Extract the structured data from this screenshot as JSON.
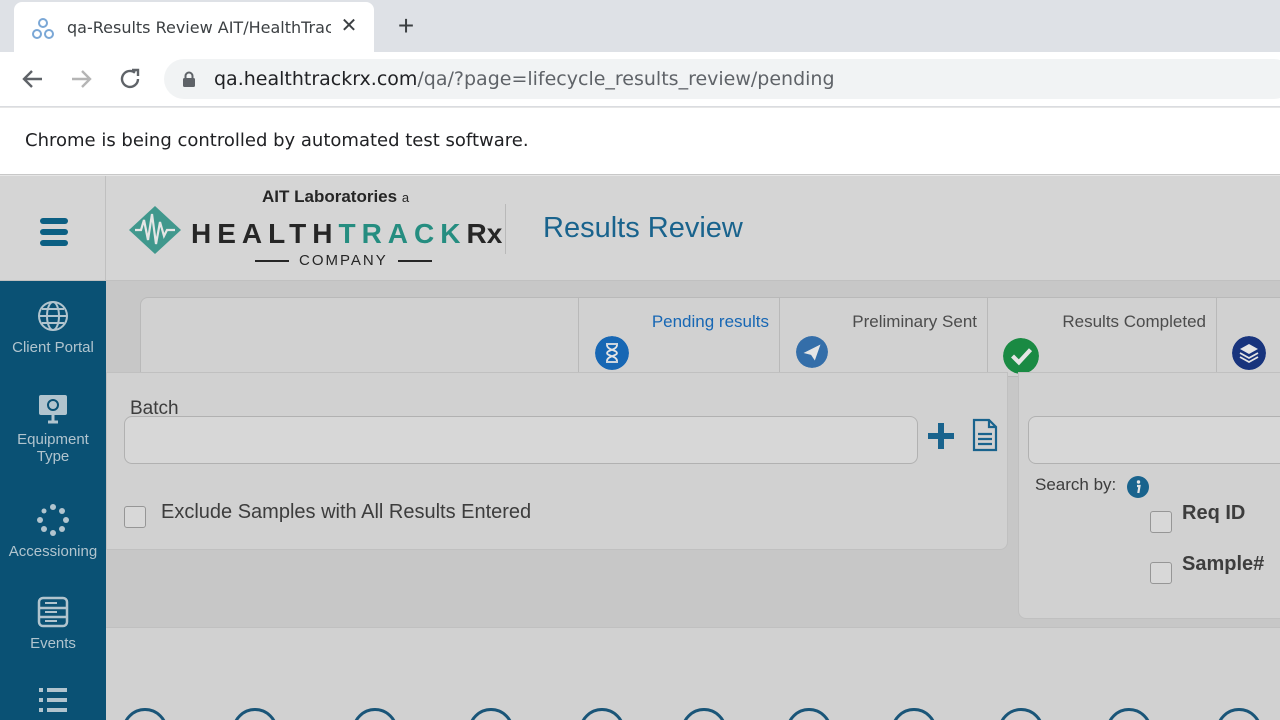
{
  "browser": {
    "tab_title": "qa-Results Review AIT/HealthTrackRx",
    "url_host": "qa.healthtrackrx.com",
    "url_path": "/qa/?page=lifecycle_results_review/pending",
    "infobar_text": "Chrome is being controlled by automated test software."
  },
  "header": {
    "logo_top": "AIT Laboratories",
    "logo_top_suffix": "a",
    "logo_main_a": "HEALTH",
    "logo_main_b": "TRACK",
    "logo_main_c": "Rx",
    "logo_company": "COMPANY",
    "page_title": "Results Review"
  },
  "sidebar": {
    "items": [
      {
        "label": "Client Portal",
        "icon": "globe-icon"
      },
      {
        "label": "Equipment Type",
        "icon": "monitor-icon"
      },
      {
        "label": "Accessioning",
        "icon": "spinner-icon"
      },
      {
        "label": "Events",
        "icon": "server-icon"
      },
      {
        "label": "",
        "icon": "list-icon"
      }
    ]
  },
  "status_tabs": [
    {
      "label": "Pending results",
      "icon": "hourglass-icon",
      "color": "#1a73c9"
    },
    {
      "label": "Preliminary Sent",
      "icon": "paper-plane-icon",
      "color": "#3a7bbd"
    },
    {
      "label": "Results Completed",
      "icon": "check-icon",
      "color": "#1e9a4b"
    },
    {
      "label": "",
      "icon": "layers-icon",
      "color": "#1b3a8c"
    }
  ],
  "batch": {
    "label": "Batch",
    "value": "",
    "exclude_label": "Exclude Samples with All Results Entered"
  },
  "search": {
    "value": "",
    "search_by_label": "Search by:",
    "options": [
      "Req ID",
      "Sample#"
    ]
  },
  "colors": {
    "sidebar": "#0c5b82",
    "accent": "#1c6f9d"
  }
}
